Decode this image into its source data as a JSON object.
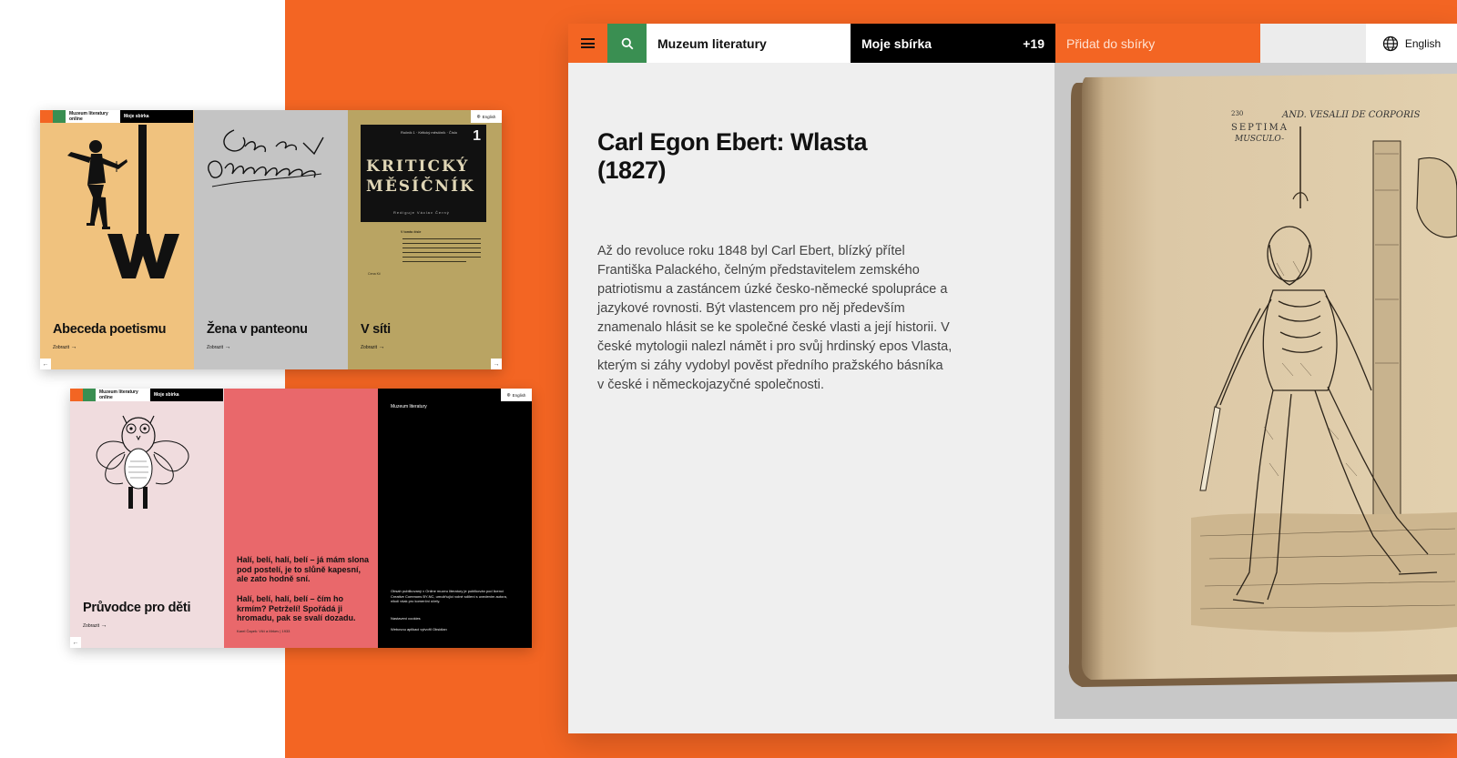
{
  "colors": {
    "orange": "#f36523",
    "green": "#3a8f52",
    "black": "#000000",
    "light_gray": "#efefef",
    "card_yellow": "#f0c27e",
    "card_gray": "#c4c4c4",
    "card_olive": "#b9a463",
    "card_pink": "#f0dcde",
    "card_coral": "#e9686b"
  },
  "main": {
    "menu_icon": "hamburger-icon",
    "search_icon": "search-icon",
    "site_title": "Muzeum literatury",
    "collection_label": "Moje sbírka",
    "collection_count": "+19",
    "add_label": "Přidat do sbírky",
    "language_icon": "globe-icon",
    "language": "English",
    "title": "Carl Egon Ebert: Wlasta (1827)",
    "body": "Až do revoluce roku 1848 byl Carl Ebert, blízký přítel Františka Palackého, čelným představitelem zemského patriotismu a zastáncem úzké česko-německé spolupráce a jazykové rovnosti. Být vlastencem pro něj především znamenalo hlásit se ke společné české vlasti a její historii. V české mytologii nalezl námět i pro svůj hrdinský epos Vlasta, kterým si záhy vydobyl pověst předního pražského básníka v české i německojazyčné společnosti.",
    "book_text_line1": "AND. VESALII DE CORPORIS",
    "book_text_line2": "SEPTIMA",
    "book_text_line3": "MUSCULO-",
    "book_page_number": "230"
  },
  "shot1": {
    "site_title": "Muzeum literatury online",
    "collection_label": "Moje sbírka",
    "language": "English",
    "cards": [
      {
        "title": "Abeceda poetismu",
        "link": "Zobrazit"
      },
      {
        "title": "Žena v panteonu",
        "link": "Zobrazit",
        "script_text": "Žena v Panteonu"
      },
      {
        "title": "V síti",
        "link": "Zobrazit"
      }
    ],
    "km_header": "Ročník 1 · Kritický měsíčník · Číslo",
    "km_number": "1",
    "km_title_line1": "KRITICKÝ",
    "km_title_line2": "MĚSÍČNÍK",
    "km_editor": "Rediguje Václav Černý",
    "km_contents_title": "V tomto čísle",
    "km_footer": "Cena Kč",
    "nav_prev": "←",
    "nav_next": "→"
  },
  "shot2": {
    "site_title": "Muzeum literatury online",
    "collection_label": "Moje sbírka",
    "language": "English",
    "card_title": "Průvodce pro děti",
    "card_link": "Zobrazit",
    "quote1": "Halí, belí, halí, belí – já mám slona pod postelí, je to slůně kapesní, ale zato hodně sní.",
    "quote2": "Halí, belí, halí, belí – čím ho krmím? Petrželí! Spořádá ji hromadu, pak se svalí dozadu.",
    "quote_source": "Karel Čapek: Vlčí a Mrkev | 1933",
    "footer_title": "Muzeum literatury",
    "footer_text": "Obsah publikovaný v Online muzeu literatury je publikován pod licencí Creative Commons BY-NC, umožňující volné sdílení s uvedením autora, nikoli však pro komerční účely.",
    "footer_link1": "Nastavení cookies",
    "footer_link2": "Webovou aplikaci vytvořil Obsidian",
    "nav_prev": "←"
  }
}
